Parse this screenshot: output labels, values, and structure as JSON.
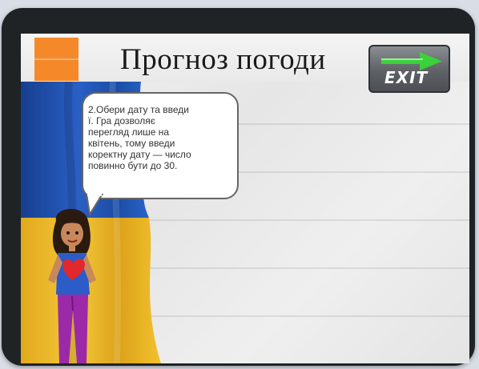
{
  "screen": {
    "title": "Прогноз погоди",
    "exit_label": "EXIT",
    "speech_text": "2.Обери дату та введи\nї.  Гра дозволяє\nперегляд лише на\nквітень, тому введи\nкоректну дату — число\nповинно бути до 30.",
    "icons": [
      "exit-arrow-icon",
      "flag-image",
      "girl-character"
    ],
    "colors": {
      "accent_orange": "#f5892a",
      "flag_blue": "#1f4fa8",
      "flag_yellow": "#f2c12e",
      "exit_arrow_green": "#3ad13a"
    }
  }
}
